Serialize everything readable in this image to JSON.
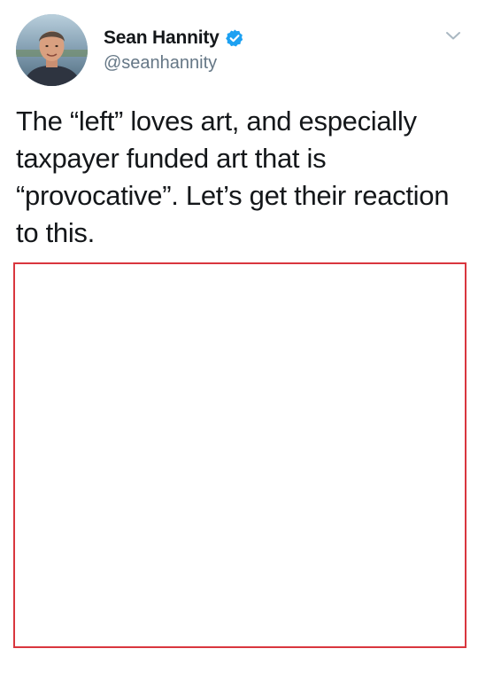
{
  "user": {
    "display_name": "Sean Hannity",
    "handle": "@seanhannity",
    "verified": true,
    "avatar": "profile-photo"
  },
  "tweet": {
    "text": "The “left” loves art, and especially taxpayer funded art that is “provocative”. Let’s get their reaction to this."
  },
  "icons": {
    "verified": "verified-badge-icon",
    "menu": "chevron-down-icon"
  },
  "colors": {
    "verified_blue": "#1da1f2",
    "handle_gray": "#657786",
    "frame_red": "#d9363e",
    "text": "#14171a"
  }
}
